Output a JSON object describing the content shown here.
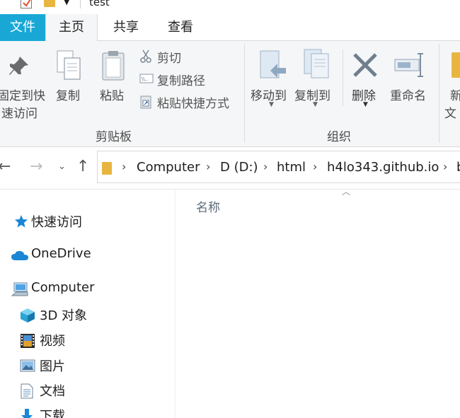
{
  "window": {
    "title": "test"
  },
  "tabs": [
    "文件",
    "主页",
    "共享",
    "查看"
  ],
  "clipboard": {
    "pin_label_line1": "固定到快",
    "pin_label_line2": "速访问",
    "copy_label": "复制",
    "paste_label": "粘贴",
    "cut_label": "剪切",
    "copy_path_label": "复制路径",
    "paste_shortcut_label": "粘贴快捷方式",
    "group_label": "剪贴板"
  },
  "organize": {
    "move_to_label": "移动到",
    "copy_to_label": "复制到",
    "delete_label": "删除",
    "rename_label": "重命名",
    "new_label_line1": "新",
    "new_label_line2": "文",
    "group_label": "组织"
  },
  "address": {
    "crumbs": [
      "Computer",
      "D (D:)",
      "html",
      "h4lo343.github.io",
      "b"
    ]
  },
  "nav_pane": {
    "quick_access": "快速访问",
    "onedrive": "OneDrive",
    "computer": "Computer",
    "objects3d": "3D 对象",
    "videos": "视频",
    "pictures": "图片",
    "documents": "文档",
    "downloads": "下载"
  },
  "content": {
    "column_name": "名称"
  },
  "colors": {
    "file_tab": "#19a8d6",
    "accent": "#1a86d6",
    "folder": "#e8b640"
  }
}
